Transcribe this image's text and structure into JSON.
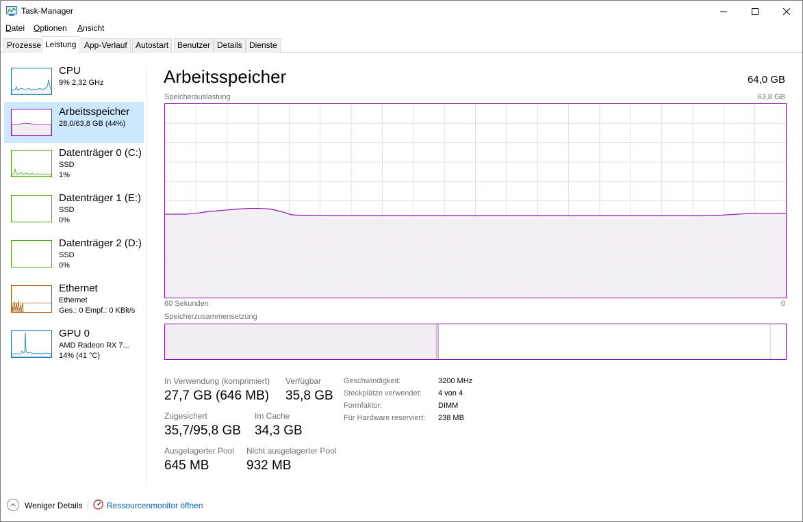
{
  "window": {
    "title": "Task-Manager"
  },
  "menu": [
    {
      "label": "Datei",
      "underline": "D",
      "rest": "atei"
    },
    {
      "label": "Optionen",
      "underline": "O",
      "rest": "ptionen"
    },
    {
      "label": "Ansicht",
      "underline": "A",
      "rest": "nsicht"
    }
  ],
  "tabs": [
    "Prozesse",
    "Leistung",
    "App-Verlauf",
    "Autostart",
    "Benutzer",
    "Details",
    "Dienste"
  ],
  "active_tab": "Leistung",
  "sidebar": {
    "items": [
      {
        "title": "CPU",
        "line1": "9%  2,32 GHz",
        "line2": "",
        "color": "#1178b5"
      },
      {
        "title": "Arbeitsspeicher",
        "line1": "28,0/63,8 GB (44%)",
        "line2": "",
        "color": "#8b12ae"
      },
      {
        "title": "Datenträger 0 (C:)",
        "line1": "SSD",
        "line2": "1%",
        "color": "#4da60c"
      },
      {
        "title": "Datenträger 1 (E:)",
        "line1": "SSD",
        "line2": "0%",
        "color": "#4da60c"
      },
      {
        "title": "Datenträger 2 (D:)",
        "line1": "SSD",
        "line2": "0%",
        "color": "#4da60c"
      },
      {
        "title": "Ethernet",
        "line1": "Ethernet",
        "line2": "Ges.: 0  Empf.: 0 KBit/s",
        "color": "#a74f01"
      },
      {
        "title": "GPU 0",
        "line1": "AMD Radeon RX 7...",
        "line2": "14%  (41 °C)",
        "color": "#1178b5"
      }
    ]
  },
  "main": {
    "title": "Arbeitsspeicher",
    "total": "64,0 GB",
    "usage_label": "Speicherauslastung",
    "usage_max": "63,8 GB",
    "time_left": "60 Sekunden",
    "time_right": "0",
    "composition_label": "Speicherzusammensetzung"
  },
  "stats": {
    "in_use_label": "In Verwendung (komprimiert)",
    "in_use_value": "27,7 GB (646 MB)",
    "available_label": "Verfügbar",
    "available_value": "35,8 GB",
    "committed_label": "Zugesichert",
    "committed_value": "35,7/95,8 GB",
    "cached_label": "Im Cache",
    "cached_value": "34,3 GB",
    "paged_label": "Ausgelagerter Pool",
    "paged_value": "645 MB",
    "nonpaged_label": "Nicht ausgelagerter Pool",
    "nonpaged_value": "932 MB"
  },
  "info": [
    {
      "label": "Geschwindigkeit:",
      "value": "3200 MHz"
    },
    {
      "label": "Steckplätze verwendet:",
      "value": "4 von 4"
    },
    {
      "label": "Formfaktor:",
      "value": "DIMM"
    },
    {
      "label": "Für Hardware reserviert:",
      "value": "238 MB"
    }
  ],
  "footer": {
    "fewer_details": "Weniger Details",
    "resource_monitor": "Ressourcenmonitor öffnen"
  },
  "chart_data": {
    "type": "area",
    "title": "Speicherauslastung",
    "xlabel": "",
    "ylabel": "",
    "x_range_label": [
      "60 Sekunden",
      "0"
    ],
    "ylim": [
      0,
      63.8
    ],
    "grid": true,
    "series": [
      {
        "values": [
          27.5,
          27.5,
          27.5,
          27.8,
          28.3,
          28.6,
          28.9,
          29.2,
          29.4,
          29.4,
          29.2,
          28.4,
          27.3,
          27.1,
          27.1,
          27.0,
          27.0,
          27.0,
          27.0,
          27.0,
          27.0,
          27.0,
          27.0,
          27.0,
          27.0,
          27.0,
          27.0,
          27.0,
          27.0,
          27.0,
          27.0,
          27.0,
          27.0,
          27.0,
          27.0,
          27.0,
          27.0,
          27.0,
          27.0,
          27.0,
          27.0,
          27.0,
          27.0,
          27.0,
          27.0,
          27.0,
          27.0,
          27.0,
          27.0,
          27.0,
          27.0,
          27.0,
          27.1,
          27.2,
          27.4,
          27.6,
          27.7,
          27.7,
          27.7,
          27.7
        ]
      }
    ],
    "composition": {
      "in_use_fraction": 0.437,
      "modified_fraction": 0.004,
      "standby_fraction": 0.534,
      "free_fraction": 0.025
    },
    "color": "#8b12ae",
    "fill": "#f1edf3"
  }
}
